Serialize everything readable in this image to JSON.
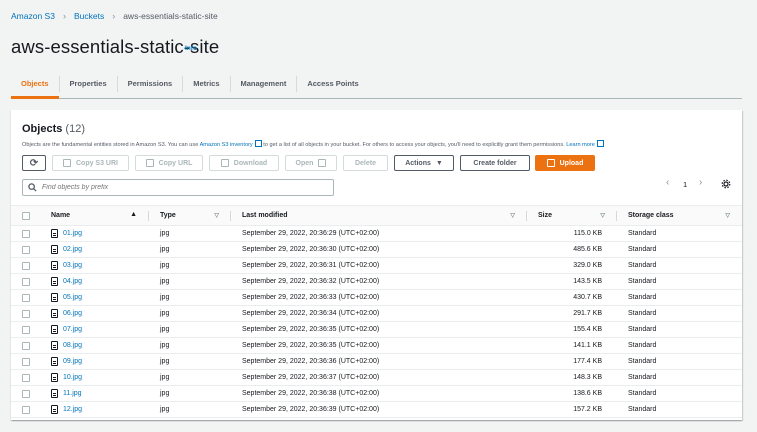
{
  "breadcrumb": {
    "root": "Amazon S3",
    "buckets": "Buckets",
    "current": "aws-essentials-static-site"
  },
  "page": {
    "title": "aws-essentials-static-site",
    "info": "Info"
  },
  "tabs": [
    {
      "label": "Objects",
      "active": true
    },
    {
      "label": "Properties"
    },
    {
      "label": "Permissions"
    },
    {
      "label": "Metrics"
    },
    {
      "label": "Management"
    },
    {
      "label": "Access Points"
    }
  ],
  "objects": {
    "title": "Objects",
    "count": "(12)",
    "desc_pre": "Objects are the fundamental entities stored in Amazon S3. You can use ",
    "desc_link": "Amazon S3 inventory",
    "desc_mid": " to get a list of all objects in your bucket. For others to access your objects, you'll need to explicitly grant them permissions. ",
    "desc_learn": "Learn more",
    "buttons": {
      "refresh": "⟳",
      "copy_uri": "Copy S3 URI",
      "copy_url": "Copy URL",
      "download": "Download",
      "open": "Open",
      "delete": "Delete",
      "actions": "Actions",
      "create_folder": "Create folder",
      "upload": "Upload"
    },
    "search_placeholder": "Find objects by prefix",
    "page": "1",
    "columns": {
      "name": "Name",
      "type": "Type",
      "modified": "Last modified",
      "size": "Size",
      "storage": "Storage class"
    },
    "rows": [
      {
        "name": "01.jpg",
        "type": "jpg",
        "modified": "September 29, 2022, 20:36:29 (UTC+02:00)",
        "size": "115.0 KB",
        "storage": "Standard"
      },
      {
        "name": "02.jpg",
        "type": "jpg",
        "modified": "September 29, 2022, 20:36:30 (UTC+02:00)",
        "size": "485.6 KB",
        "storage": "Standard"
      },
      {
        "name": "03.jpg",
        "type": "jpg",
        "modified": "September 29, 2022, 20:36:31 (UTC+02:00)",
        "size": "329.0 KB",
        "storage": "Standard"
      },
      {
        "name": "04.jpg",
        "type": "jpg",
        "modified": "September 29, 2022, 20:36:32 (UTC+02:00)",
        "size": "143.5 KB",
        "storage": "Standard"
      },
      {
        "name": "05.jpg",
        "type": "jpg",
        "modified": "September 29, 2022, 20:36:33 (UTC+02:00)",
        "size": "430.7 KB",
        "storage": "Standard"
      },
      {
        "name": "06.jpg",
        "type": "jpg",
        "modified": "September 29, 2022, 20:36:34 (UTC+02:00)",
        "size": "291.7 KB",
        "storage": "Standard"
      },
      {
        "name": "07.jpg",
        "type": "jpg",
        "modified": "September 29, 2022, 20:36:35 (UTC+02:00)",
        "size": "155.4 KB",
        "storage": "Standard"
      },
      {
        "name": "08.jpg",
        "type": "jpg",
        "modified": "September 29, 2022, 20:36:35 (UTC+02:00)",
        "size": "141.1 KB",
        "storage": "Standard"
      },
      {
        "name": "09.jpg",
        "type": "jpg",
        "modified": "September 29, 2022, 20:36:36 (UTC+02:00)",
        "size": "177.4 KB",
        "storage": "Standard"
      },
      {
        "name": "10.jpg",
        "type": "jpg",
        "modified": "September 29, 2022, 20:36:37 (UTC+02:00)",
        "size": "148.3 KB",
        "storage": "Standard"
      },
      {
        "name": "11.jpg",
        "type": "jpg",
        "modified": "September 29, 2022, 20:36:38 (UTC+02:00)",
        "size": "138.6 KB",
        "storage": "Standard"
      },
      {
        "name": "12.jpg",
        "type": "jpg",
        "modified": "September 29, 2022, 20:36:39 (UTC+02:00)",
        "size": "157.2 KB",
        "storage": "Standard"
      }
    ]
  },
  "colors": {
    "accent": "#ec7211",
    "link": "#0073bb",
    "background": "#f2f3f3"
  }
}
